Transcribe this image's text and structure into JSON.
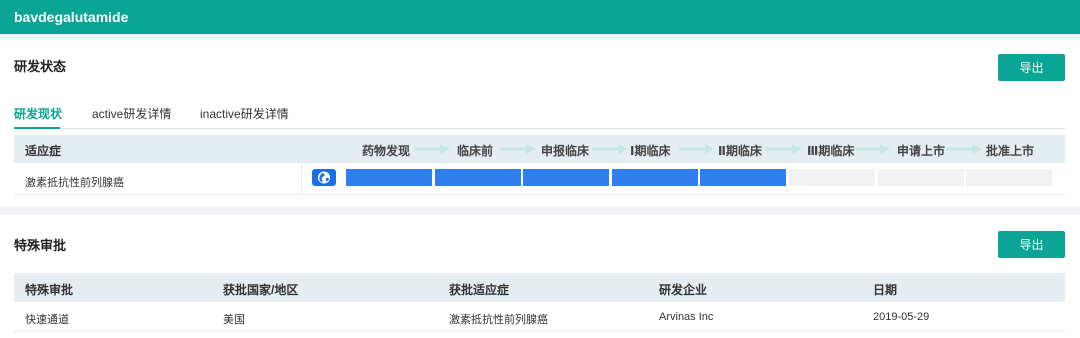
{
  "header": {
    "title": "bavdegalutamide"
  },
  "dev_status": {
    "title": "研发状态",
    "export_label": "导出",
    "tabs": [
      {
        "label": "研发现状",
        "active": true
      },
      {
        "label": "active研发详情",
        "active": false
      },
      {
        "label": "inactive研发详情",
        "active": false
      }
    ],
    "indication_header": "适应症",
    "stages": [
      "药物发现",
      "临床前",
      "申报临床",
      "Ⅰ期临床",
      "Ⅱ期临床",
      "Ⅲ期临床",
      "申请上市",
      "批准上市"
    ],
    "rows": [
      {
        "indication": "激素抵抗性前列腺癌",
        "icon": "globe-icon",
        "progress_stages_filled": 5,
        "progress_stages_total": 8
      }
    ]
  },
  "special_approval": {
    "title": "特殊审批",
    "export_label": "导出",
    "columns": [
      "特殊审批",
      "获批国家/地区",
      "获批适应症",
      "研发企业",
      "日期"
    ],
    "rows": [
      [
        "快速通道",
        "美国",
        "激素抵抗性前列腺癌",
        "Arvinas Inc",
        "2019-05-29"
      ]
    ]
  },
  "colors": {
    "brand": "#0aa594",
    "progress": "#2f7ff0",
    "header_bg": "#e4edf1"
  }
}
